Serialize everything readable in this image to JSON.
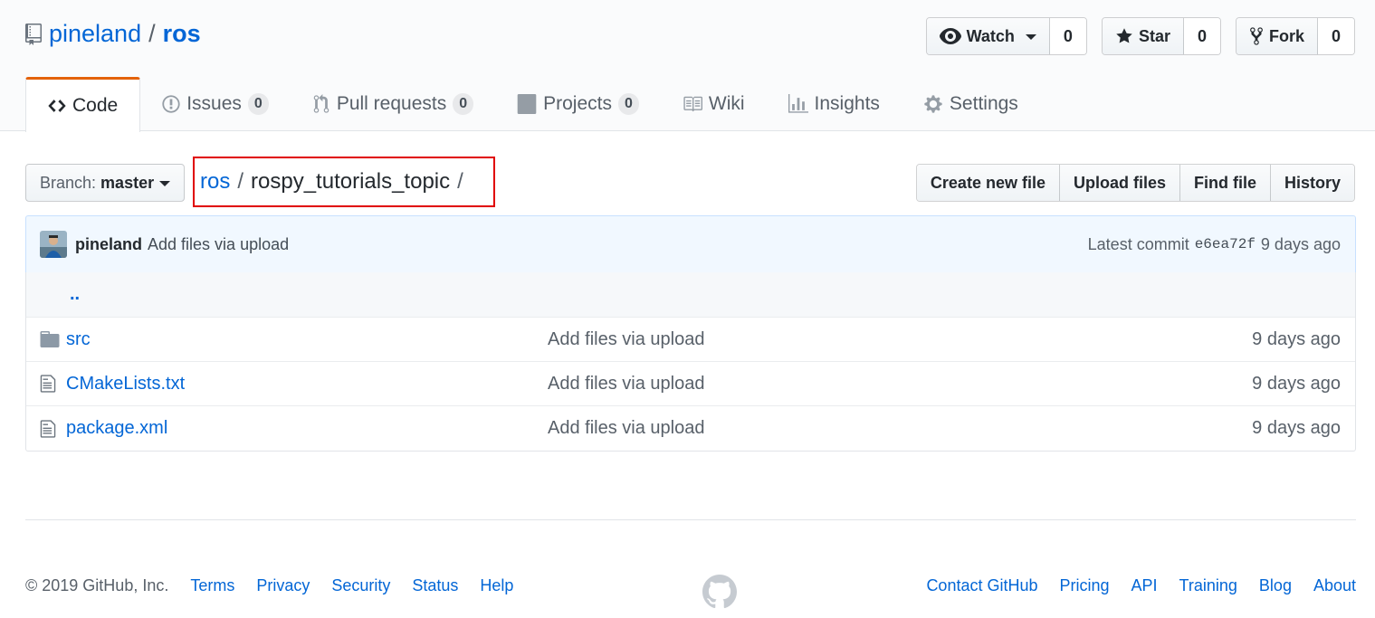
{
  "repo": {
    "owner": "pineland",
    "separator": "/",
    "name": "ros"
  },
  "actions": {
    "watch_label": "Watch",
    "watch_count": "0",
    "star_label": "Star",
    "star_count": "0",
    "fork_label": "Fork",
    "fork_count": "0"
  },
  "tabs": [
    {
      "label": "Code",
      "icon": "code-icon",
      "counter": ""
    },
    {
      "label": "Issues",
      "icon": "issue-opened-icon",
      "counter": "0"
    },
    {
      "label": "Pull requests",
      "icon": "git-pull-request-icon",
      "counter": "0"
    },
    {
      "label": "Projects",
      "icon": "project-icon",
      "counter": "0"
    },
    {
      "label": "Wiki",
      "icon": "book-icon",
      "counter": ""
    },
    {
      "label": "Insights",
      "icon": "graph-icon",
      "counter": ""
    },
    {
      "label": "Settings",
      "icon": "gear-icon",
      "counter": ""
    }
  ],
  "branch": {
    "prefix": "Branch:",
    "name": "master"
  },
  "breadcrumb": {
    "root": "ros",
    "sep": "/",
    "current": "rospy_tutorials_topic",
    "trailing": "/",
    "highlight_color": "#e00000"
  },
  "file_actions": {
    "create": "Create new file",
    "upload": "Upload files",
    "find": "Find file",
    "history": "History"
  },
  "commit": {
    "author": "pineland",
    "message": "Add files via upload",
    "latest_label": "Latest commit",
    "sha": "e6ea72f",
    "age": "9 days ago"
  },
  "files": {
    "up": "..",
    "rows": [
      {
        "type": "folder",
        "icon": "file-directory-icon",
        "name": "src",
        "message": "Add files via upload",
        "age": "9 days ago"
      },
      {
        "type": "file",
        "icon": "file-icon",
        "name": "CMakeLists.txt",
        "message": "Add files via upload",
        "age": "9 days ago"
      },
      {
        "type": "file",
        "icon": "file-icon",
        "name": "package.xml",
        "message": "Add files via upload",
        "age": "9 days ago"
      }
    ]
  },
  "footer": {
    "copyright": "© 2019 GitHub, Inc.",
    "left_links": [
      "Terms",
      "Privacy",
      "Security",
      "Status",
      "Help"
    ],
    "right_links": [
      "Contact GitHub",
      "Pricing",
      "API",
      "Training",
      "Blog",
      "About"
    ]
  },
  "colors": {
    "link": "#0366d6",
    "tab_accent": "#e36209",
    "commit_bg": "#f1f8ff"
  }
}
